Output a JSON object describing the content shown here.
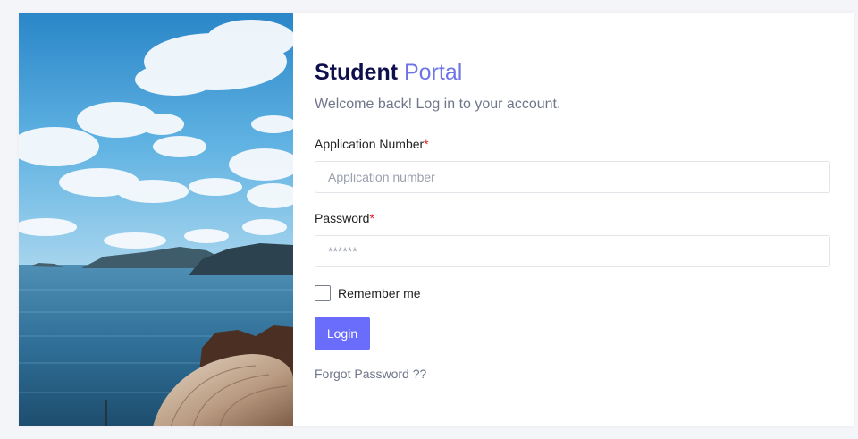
{
  "header": {
    "title_strong": "Student",
    "title_light": "Portal",
    "subtitle": "Welcome back! Log in to your account."
  },
  "form": {
    "application_number": {
      "label": "Application Number",
      "required_mark": "*",
      "value": "",
      "placeholder": "Application number"
    },
    "password": {
      "label": "Password",
      "required_mark": "*",
      "value": "",
      "placeholder": "******"
    },
    "remember_me": {
      "label": "Remember me",
      "checked": false
    },
    "login_label": "Login",
    "forgot_label": "Forgot Password ??"
  },
  "colors": {
    "accent": "#6a6dfb",
    "title_dark": "#0e0f4d",
    "title_light": "#6e75e6",
    "required": "#e01f1f",
    "muted_text": "#70768a"
  }
}
